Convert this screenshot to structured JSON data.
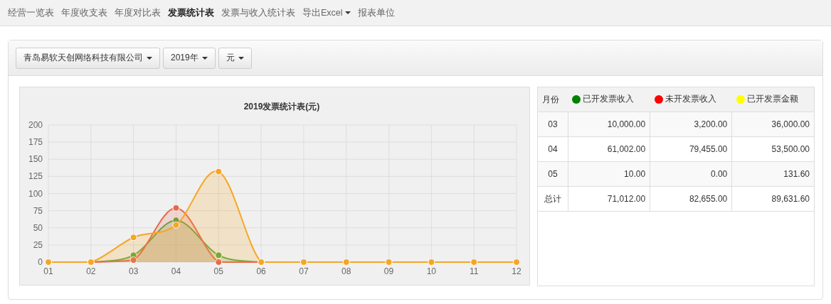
{
  "nav": [
    {
      "label": "经营一览表",
      "selected": false,
      "dropdown": false
    },
    {
      "label": "年度收支表",
      "selected": false,
      "dropdown": false
    },
    {
      "label": "年度对比表",
      "selected": false,
      "dropdown": false
    },
    {
      "label": "发票统计表",
      "selected": true,
      "dropdown": false
    },
    {
      "label": "发票与收入统计表",
      "selected": false,
      "dropdown": false
    },
    {
      "label": "导出Excel",
      "selected": false,
      "dropdown": true
    },
    {
      "label": "报表单位",
      "selected": false,
      "dropdown": false
    }
  ],
  "filters": [
    {
      "label": "青岛易软天创网络科技有限公司"
    },
    {
      "label": "2019年"
    },
    {
      "label": "元"
    }
  ],
  "chart": {
    "chart_data": {
      "type": "area",
      "title": "2019发票统计表(元)",
      "categories": [
        "01",
        "02",
        "03",
        "04",
        "05",
        "06",
        "07",
        "08",
        "09",
        "10",
        "11",
        "12"
      ],
      "ylim": [
        0,
        200
      ],
      "grid": true,
      "yticks": [
        0,
        25,
        50,
        75,
        100,
        125,
        150,
        175,
        200
      ],
      "series": [
        {
          "color": "#5aa93a",
          "values": [
            0,
            0,
            10,
            61,
            10,
            0,
            0,
            0,
            0,
            0,
            0,
            0
          ]
        },
        {
          "color": "#e8684a",
          "values": [
            0,
            0,
            3,
            79,
            0,
            0,
            0,
            0,
            0,
            0,
            0,
            0
          ]
        },
        {
          "color": "#f5a623",
          "values": [
            0,
            0,
            36,
            54,
            132,
            0,
            0,
            0,
            0,
            0,
            0,
            0
          ]
        }
      ]
    }
  },
  "table": {
    "columns": [
      {
        "label": "月份"
      },
      {
        "label": "已开发票收入",
        "color": "#008000"
      },
      {
        "label": "未开发票收入",
        "color": "#ff0000"
      },
      {
        "label": "已开发票金额",
        "color": "#ffff00"
      }
    ],
    "rows": [
      [
        "03",
        "10,000.00",
        "3,200.00",
        "36,000.00"
      ],
      [
        "04",
        "61,002.00",
        "79,455.00",
        "53,500.00"
      ],
      [
        "05",
        "10.00",
        "0.00",
        "131.60"
      ],
      [
        "总计",
        "71,012.00",
        "82,655.00",
        "89,631.60"
      ]
    ]
  }
}
